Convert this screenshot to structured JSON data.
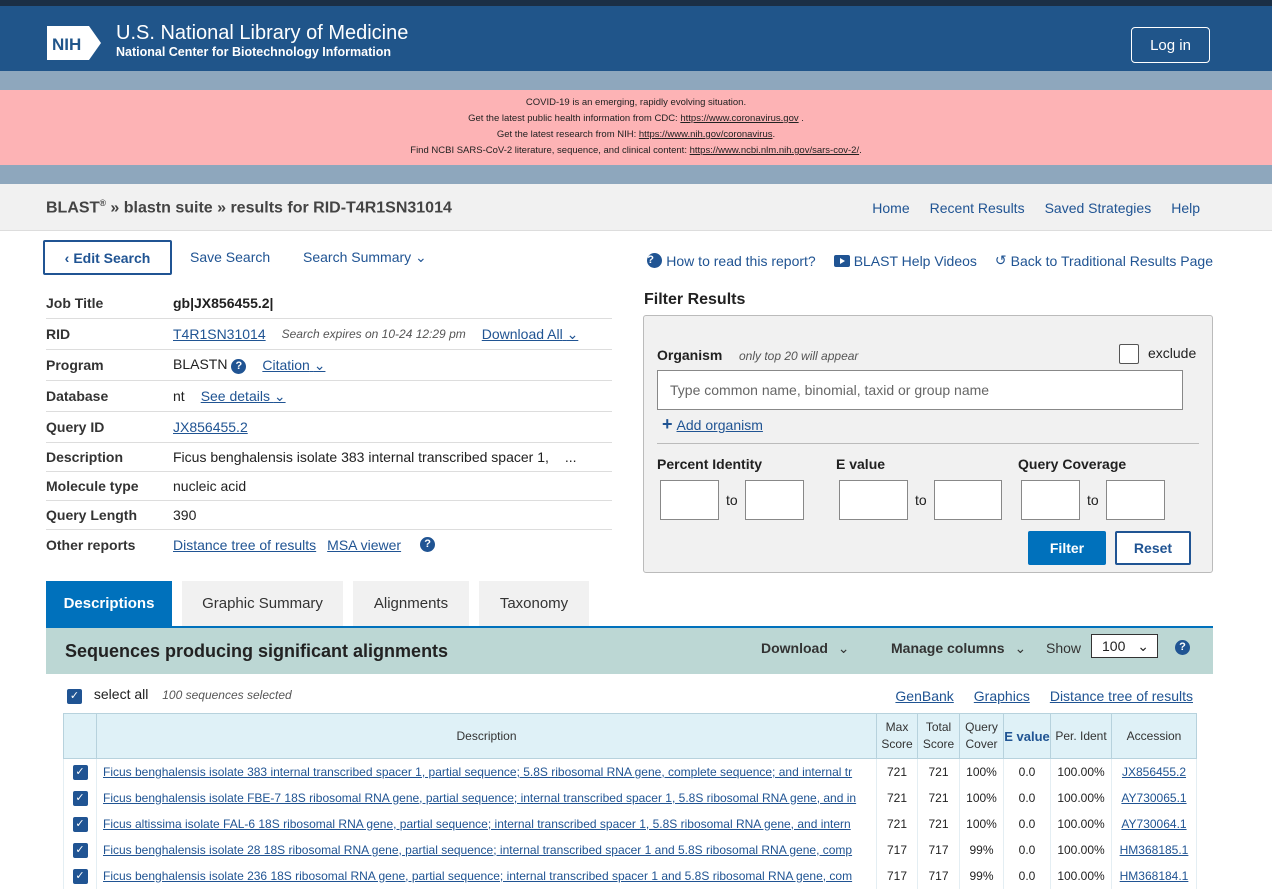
{
  "header": {
    "logo_text": "NIH",
    "title": "U.S. National Library of Medicine",
    "subtitle": "National Center for Biotechnology Information",
    "login_label": "Log in"
  },
  "covid_banner": {
    "line1": "COVID-19 is an emerging, rapidly evolving situation.",
    "line2_prefix": "Get the latest public health information from CDC: ",
    "line2_link": "https://www.coronavirus.gov",
    "line2_suffix": " .",
    "line3_prefix": "Get the latest research from NIH: ",
    "line3_link": "https://www.nih.gov/coronavirus",
    "line3_suffix": ".",
    "line4_prefix": "Find NCBI SARS-CoV-2 literature, sequence, and clinical content: ",
    "line4_link": "https://www.ncbi.nlm.nih.gov/sars-cov-2/",
    "line4_suffix": "."
  },
  "breadcrumb": {
    "blast": "BLAST",
    "reg": "®",
    "rest": " » blastn suite » results for RID-T4R1SN31014"
  },
  "topnav": [
    "Home",
    "Recent Results",
    "Saved Strategies",
    "Help"
  ],
  "edit_row": {
    "edit_search": "Edit Search",
    "save_search": "Save Search",
    "search_summary": "Search Summary",
    "how_to_read": "How to read this report?",
    "help_videos": "BLAST Help Videos",
    "back_traditional": "Back to Traditional Results Page"
  },
  "job": {
    "title_label": "Job Title",
    "title_value": "gb|JX856455.2|",
    "rid_label": "RID",
    "rid_value": "T4R1SN31014",
    "rid_expires": "Search expires on 10-24 12:29 pm",
    "download_all": "Download All",
    "program_label": "Program",
    "program_value": "BLASTN",
    "citation": "Citation",
    "database_label": "Database",
    "database_value": "nt",
    "see_details": "See details",
    "query_id_label": "Query ID",
    "query_id_value": "JX856455.2",
    "description_label": "Description",
    "description_value": "Ficus benghalensis isolate 383 internal transcribed spacer 1,",
    "description_more": "...",
    "molecule_label": "Molecule type",
    "molecule_value": "nucleic acid",
    "length_label": "Query Length",
    "length_value": "390",
    "other_label": "Other reports",
    "other_link1": "Distance tree of results",
    "other_link2": "MSA viewer"
  },
  "filter": {
    "title": "Filter Results",
    "organism_label": "Organism",
    "organism_hint": "only top 20 will appear",
    "exclude_label": "exclude",
    "organism_placeholder": "Type common  name, binomial, taxid or group  name",
    "add_organism": "Add organism",
    "percent_identity": "Percent Identity",
    "e_value": "E value",
    "query_coverage": "Query Coverage",
    "to": "to",
    "filter_btn": "Filter",
    "reset_btn": "Reset"
  },
  "tabs": [
    "Descriptions",
    "Graphic Summary",
    "Alignments",
    "Taxonomy"
  ],
  "sequences": {
    "title": "Sequences producing significant alignments",
    "download": "Download",
    "manage_columns": "Manage columns",
    "show_label": "Show",
    "show_value": "100",
    "select_all": "select all",
    "selected_count": "100 sequences selected",
    "link_genbank": "GenBank",
    "link_graphics": "Graphics",
    "link_tree": "Distance tree of results"
  },
  "table": {
    "headers": {
      "description": "Description",
      "max_score": "Max Score",
      "total_score": "Total Score",
      "query_cover": "Query Cover",
      "e_value": "E value",
      "per_ident": "Per. Ident",
      "accession": "Accession"
    },
    "rows": [
      {
        "desc": "Ficus benghalensis isolate 383 internal transcribed spacer 1, partial sequence; 5.8S ribosomal RNA gene, complete sequence; and internal tr",
        "max": "721",
        "total": "721",
        "cover": "100%",
        "e": "0.0",
        "ident": "100.00%",
        "acc": "JX856455.2"
      },
      {
        "desc": "Ficus benghalensis isolate FBE-7 18S ribosomal RNA gene, partial sequence; internal transcribed spacer 1, 5.8S ribosomal RNA gene, and in",
        "max": "721",
        "total": "721",
        "cover": "100%",
        "e": "0.0",
        "ident": "100.00%",
        "acc": "AY730065.1"
      },
      {
        "desc": "Ficus altissima isolate FAL-6 18S ribosomal RNA gene, partial sequence; internal transcribed spacer 1, 5.8S ribosomal RNA gene, and intern",
        "max": "721",
        "total": "721",
        "cover": "100%",
        "e": "0.0",
        "ident": "100.00%",
        "acc": "AY730064.1"
      },
      {
        "desc": "Ficus benghalensis isolate 28 18S ribosomal RNA gene, partial sequence; internal transcribed spacer 1 and 5.8S ribosomal RNA gene, comp",
        "max": "717",
        "total": "717",
        "cover": "99%",
        "e": "0.0",
        "ident": "100.00%",
        "acc": "HM368185.1"
      },
      {
        "desc": "Ficus benghalensis isolate 236 18S ribosomal RNA gene, partial sequence; internal transcribed spacer 1 and 5.8S ribosomal RNA gene, com",
        "max": "717",
        "total": "717",
        "cover": "99%",
        "e": "0.0",
        "ident": "100.00%",
        "acc": "HM368184.1"
      }
    ]
  },
  "colors": {
    "nih_blue": "#20558a",
    "link_blue": "#205493",
    "covid_pink": "#fdb3b5",
    "seq_header_bg": "#bcd7d4",
    "active_tab": "#0071bc"
  }
}
